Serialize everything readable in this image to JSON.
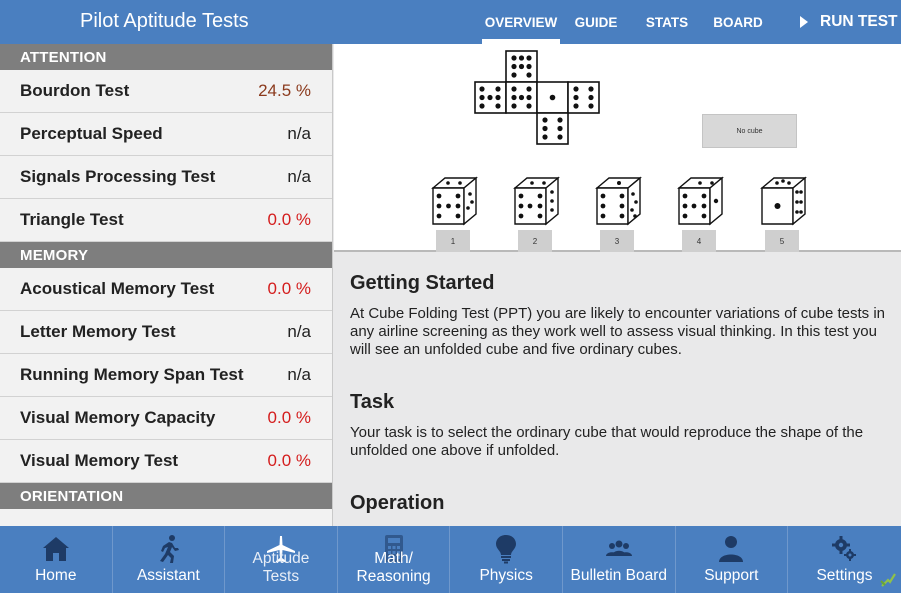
{
  "header": {
    "title": "Pilot Aptitude Tests",
    "tabs": [
      {
        "label": "OVERVIEW",
        "active": true
      },
      {
        "label": "GUIDE",
        "active": false
      },
      {
        "label": "STATS",
        "active": false
      },
      {
        "label": "BOARD",
        "active": false
      }
    ],
    "run_test_label": "RUN TEST"
  },
  "sidebar": {
    "sections": [
      {
        "title": "ATTENTION",
        "items": [
          {
            "label": "Bourdon Test",
            "value": "24.5 %",
            "status": "brown"
          },
          {
            "label": "Perceptual Speed",
            "value": "n/a",
            "status": "neutral"
          },
          {
            "label": "Signals Processing Test",
            "value": "n/a",
            "status": "neutral"
          },
          {
            "label": "Triangle Test",
            "value": "0.0 %",
            "status": "red"
          }
        ]
      },
      {
        "title": "MEMORY",
        "items": [
          {
            "label": "Acoustical Memory Test",
            "value": "0.0 %",
            "status": "red"
          },
          {
            "label": "Letter Memory Test",
            "value": "n/a",
            "status": "neutral"
          },
          {
            "label": "Running Memory Span Test",
            "value": "n/a",
            "status": "neutral"
          },
          {
            "label": "Visual Memory Capacity",
            "value": "0.0 %",
            "status": "red"
          },
          {
            "label": "Visual Memory Test",
            "value": "0.0 %",
            "status": "red"
          }
        ]
      },
      {
        "title": "ORIENTATION",
        "items": []
      }
    ]
  },
  "preview": {
    "no_cube_label": "No cube",
    "choices": [
      "1",
      "2",
      "3",
      "4",
      "5"
    ]
  },
  "content": {
    "getting_started_title": "Getting Started",
    "getting_started_text": "At Cube Folding Test (PPT) you are likely to encounter variations of cube tests in any airline screening as they work well to assess visual thinking. In this test you will see an unfolded cube and five ordinary cubes.",
    "task_title": "Task",
    "task_text": "Your task is to select the ordinary cube that would reproduce the shape of the unfolded one above if unfolded.",
    "operation_title": "Operation"
  },
  "bottom_nav": [
    {
      "label": "Home",
      "icon": "home-icon"
    },
    {
      "label": "Assistant",
      "icon": "running-person-icon"
    },
    {
      "label": "Aptitude\nTests",
      "icon": "airplane-icon"
    },
    {
      "label": "Math/\nReasoning",
      "icon": "calculator-icon"
    },
    {
      "label": "Physics",
      "icon": "lightbulb-icon"
    },
    {
      "label": "Bulletin Board",
      "icon": "group-icon"
    },
    {
      "label": "Support",
      "icon": "person-icon"
    },
    {
      "label": "Settings",
      "icon": "gears-icon"
    }
  ],
  "colors": {
    "primary": "#4a7fc0",
    "section_header": "#7e7e7e",
    "value_red": "#d41d1d",
    "value_brown": "#8b3a1d"
  }
}
